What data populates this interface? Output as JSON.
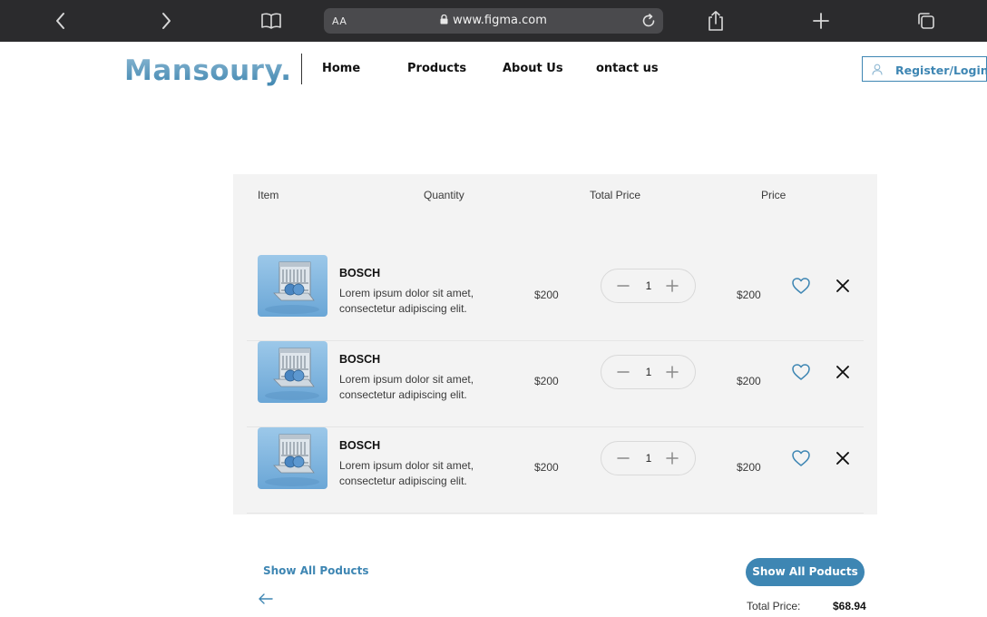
{
  "browser": {
    "text_size_label": "AA",
    "url": "www.figma.com"
  },
  "header": {
    "logo": "Mansoury.",
    "nav": [
      "Home",
      "Products",
      "About Us",
      "ontact us"
    ],
    "register_label": "Register/Login"
  },
  "cart": {
    "columns": {
      "item": "Item",
      "quantity": "Quantity",
      "total_price": "Total Price",
      "price": "Price"
    },
    "items": [
      {
        "name": "BOSCH",
        "description": "Lorem ipsum dolor sit amet, consectetur adipiscing elit.",
        "unit_price": "$200",
        "quantity": "1",
        "total": "$200"
      },
      {
        "name": "BOSCH",
        "description": "Lorem ipsum dolor sit amet, consectetur adipiscing elit.",
        "unit_price": "$200",
        "quantity": "1",
        "total": "$200"
      },
      {
        "name": "BOSCH",
        "description": "Lorem ipsum dolor sit amet, consectetur adipiscing elit.",
        "unit_price": "$200",
        "quantity": "1",
        "total": "$200"
      }
    ]
  },
  "footer": {
    "show_link": "Show All Poducts",
    "show_button": "Show All Poducts",
    "total_label": "Total Price:",
    "total_value": "$68.94"
  },
  "colors": {
    "accent": "#3e86b3",
    "browser_bar": "#2b2b2d",
    "panel": "#f3f3f3"
  },
  "icons": [
    "back-chevron-icon",
    "forward-chevron-icon",
    "bookmarks-icon",
    "lock-icon",
    "reload-icon",
    "share-icon",
    "new-tab-icon",
    "tabs-icon",
    "user-icon",
    "minus-icon",
    "plus-icon",
    "heart-icon",
    "close-icon",
    "arrow-left-icon"
  ]
}
